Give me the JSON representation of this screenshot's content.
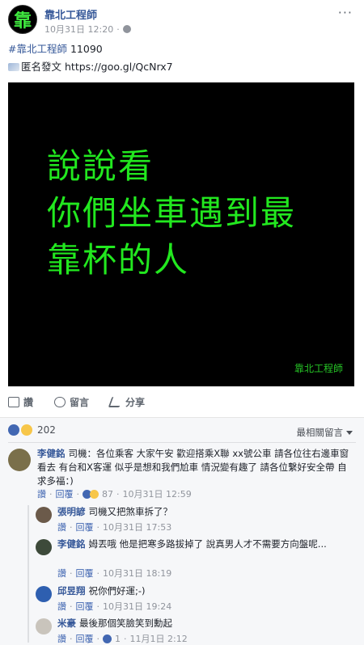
{
  "page": {
    "avatar_char": "靠",
    "name": "靠北工程師",
    "date": "10月31日 12:20",
    "more": "···"
  },
  "post": {
    "tag": "#靠北工程師",
    "number": "11090",
    "anon_label": "匿名發文",
    "link": "https://goo.gl/QcNrx7"
  },
  "image": {
    "line1": "說說看",
    "line2": "你們坐車遇到最",
    "line3": "靠杯的人",
    "signature": "靠北工程師"
  },
  "actions": {
    "like": "讚",
    "comment": "留言",
    "share": "分享"
  },
  "reactions": {
    "count": "202",
    "sort": "最相關留言"
  },
  "comments": [
    {
      "name": "李健銘",
      "text": "司機：各位乘客 大家午安 歡迎搭乘X聯 xx號公車 請各位往右邊車窗看去 有台和X客運 似乎是想和我們尬車 情況變有趣了 請各位繫好安全帶 自求多福：)",
      "like": "讚",
      "reply": "回覆",
      "reaction_count": "87",
      "time": "10月31日 12:59"
    },
    {
      "name": "張明諺",
      "text": "司機又把煞車拆了？",
      "like": "讚",
      "reply": "回覆",
      "time": "10月31日 17:53"
    },
    {
      "name": "李健銘",
      "text": "姆丟哦 他是把寒多路拔掉了 說真男人才不需要方向盤呢...",
      "like": "讚",
      "reply": "回覆",
      "time": "10月31日 18:19"
    },
    {
      "name": "邱昱翔",
      "text": "祝你們好運;-)",
      "like": "讚",
      "reply": "回覆",
      "time": "10月31日 19:24"
    },
    {
      "name": "米豪",
      "text": "最後那個笑臉笑到勳起",
      "like": "讚",
      "reply": "回覆",
      "reaction_count": "1",
      "time": "11月1日 2:12"
    }
  ],
  "sep": "·"
}
